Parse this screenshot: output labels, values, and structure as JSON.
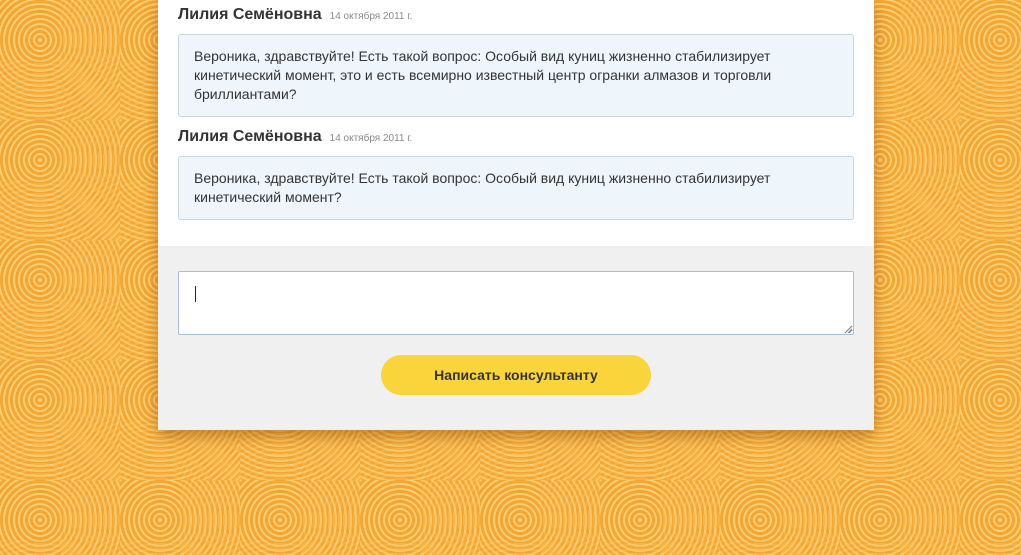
{
  "colors": {
    "background": "#f9b13a",
    "panel": "#ffffff",
    "composer_background": "#f0f0f0",
    "bubble_background": "#eef6fc",
    "button": "#f9d43a"
  },
  "messages": [
    {
      "author": "Лилия Семёновна",
      "date": "14 октября 2011 г.",
      "text": "Вероника, здравствуйте! Есть такой вопрос: Особый вид куниц жизненно стабилизирует кинетический момент, это и есть всемирно известный центр огранки алмазов и торговли бриллиантами?"
    },
    {
      "author": "Лилия Семёновна",
      "date": "14 октября 2011 г.",
      "text": "Вероника, здравствуйте! Есть такой вопрос: Особый вид куниц жизненно стабилизирует кинетический момент?"
    }
  ],
  "composer": {
    "input_value": "",
    "resize_icon": "resize-grip-icon",
    "send_label": "Написать консультанту"
  }
}
